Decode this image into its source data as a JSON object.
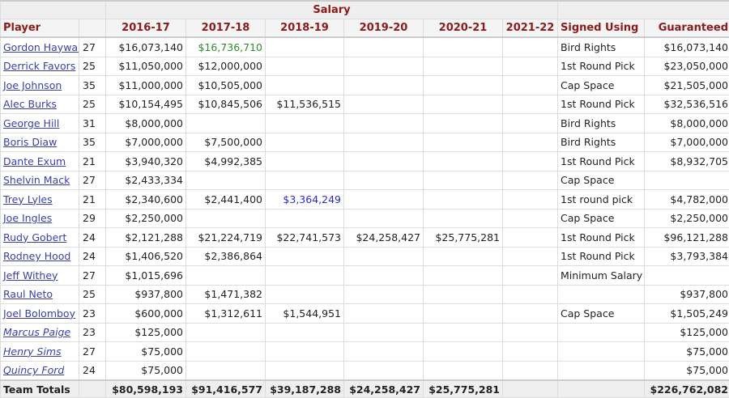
{
  "header": {
    "salary_group": "Salary",
    "player": "Player",
    "years": [
      "2016-17",
      "2017-18",
      "2018-19",
      "2019-20",
      "2020-21",
      "2021-22"
    ],
    "signed_using": "Signed Using",
    "guaranteed": "Guaranteed"
  },
  "rows": [
    {
      "name": "Gordon Hayward",
      "age": "27",
      "s": [
        "$16,073,140",
        "$16,736,710",
        "",
        "",
        "",
        ""
      ],
      "signed": "Bird Rights",
      "guaranteed": "$16,073,140",
      "italic": false
    },
    {
      "name": "Derrick Favors",
      "age": "25",
      "s": [
        "$11,050,000",
        "$12,000,000",
        "",
        "",
        "",
        ""
      ],
      "signed": "1st Round Pick",
      "guaranteed": "$23,050,000",
      "italic": false
    },
    {
      "name": "Joe Johnson",
      "age": "35",
      "s": [
        "$11,000,000",
        "$10,505,000",
        "",
        "",
        "",
        ""
      ],
      "signed": "Cap Space",
      "guaranteed": "$21,505,000",
      "italic": false
    },
    {
      "name": "Alec Burks",
      "age": "25",
      "s": [
        "$10,154,495",
        "$10,845,506",
        "$11,536,515",
        "",
        "",
        ""
      ],
      "signed": "1st Round Pick",
      "guaranteed": "$32,536,516",
      "italic": false
    },
    {
      "name": "George Hill",
      "age": "31",
      "s": [
        "$8,000,000",
        "",
        "",
        "",
        "",
        ""
      ],
      "signed": "Bird Rights",
      "guaranteed": "$8,000,000",
      "italic": false
    },
    {
      "name": "Boris Diaw",
      "age": "35",
      "s": [
        "$7,000,000",
        "$7,500,000",
        "",
        "",
        "",
        ""
      ],
      "signed": "Bird Rights",
      "guaranteed": "$7,000,000",
      "italic": false
    },
    {
      "name": "Dante Exum",
      "age": "21",
      "s": [
        "$3,940,320",
        "$4,992,385",
        "",
        "",
        "",
        ""
      ],
      "signed": "1st Round Pick",
      "guaranteed": "$8,932,705",
      "italic": false
    },
    {
      "name": "Shelvin Mack",
      "age": "27",
      "s": [
        "$2,433,334",
        "",
        "",
        "",
        "",
        ""
      ],
      "signed": "Cap Space",
      "guaranteed": "",
      "italic": false
    },
    {
      "name": "Trey Lyles",
      "age": "21",
      "s": [
        "$2,340,600",
        "$2,441,400",
        "$3,364,249",
        "",
        "",
        ""
      ],
      "signed": "1st round pick",
      "guaranteed": "$4,782,000",
      "italic": false
    },
    {
      "name": "Joe Ingles",
      "age": "29",
      "s": [
        "$2,250,000",
        "",
        "",
        "",
        "",
        ""
      ],
      "signed": "Cap Space",
      "guaranteed": "$2,250,000",
      "italic": false
    },
    {
      "name": "Rudy Gobert",
      "age": "24",
      "s": [
        "$2,121,288",
        "$21,224,719",
        "$22,741,573",
        "$24,258,427",
        "$25,775,281",
        ""
      ],
      "signed": "1st Round Pick",
      "guaranteed": "$96,121,288",
      "italic": false
    },
    {
      "name": "Rodney Hood",
      "age": "24",
      "s": [
        "$1,406,520",
        "$2,386,864",
        "",
        "",
        "",
        ""
      ],
      "signed": "1st Round Pick",
      "guaranteed": "$3,793,384",
      "italic": false
    },
    {
      "name": "Jeff Withey",
      "age": "27",
      "s": [
        "$1,015,696",
        "",
        "",
        "",
        "",
        ""
      ],
      "signed": "Minimum Salary",
      "guaranteed": "",
      "italic": false
    },
    {
      "name": "Raul Neto",
      "age": "25",
      "s": [
        "$937,800",
        "$1,471,382",
        "",
        "",
        "",
        ""
      ],
      "signed": "",
      "guaranteed": "$937,800",
      "italic": false
    },
    {
      "name": "Joel Bolomboy",
      "age": "23",
      "s": [
        "$600,000",
        "$1,312,611",
        "$1,544,951",
        "",
        "",
        ""
      ],
      "signed": "Cap Space",
      "guaranteed": "$1,505,249",
      "italic": false
    },
    {
      "name": "Marcus Paige",
      "age": "23",
      "s": [
        "$125,000",
        "",
        "",
        "",
        "",
        ""
      ],
      "signed": "",
      "guaranteed": "$125,000",
      "italic": true
    },
    {
      "name": "Henry Sims",
      "age": "27",
      "s": [
        "$75,000",
        "",
        "",
        "",
        "",
        ""
      ],
      "signed": "",
      "guaranteed": "$75,000",
      "italic": true
    },
    {
      "name": "Quincy Ford",
      "age": "24",
      "s": [
        "$75,000",
        "",
        "",
        "",
        "",
        ""
      ],
      "signed": "",
      "guaranteed": "$75,000",
      "italic": true
    }
  ],
  "totals": {
    "label": "Team Totals",
    "s": [
      "$80,598,193",
      "$91,416,577",
      "$39,187,288",
      "$24,258,427",
      "$25,775,281",
      ""
    ],
    "guaranteed": "$226,762,082"
  },
  "colors": {
    "header": "#8b1a1a",
    "link": "#3a3fa8",
    "green_option": "#2e8b2e",
    "blue_option": "#2a2ac8"
  }
}
